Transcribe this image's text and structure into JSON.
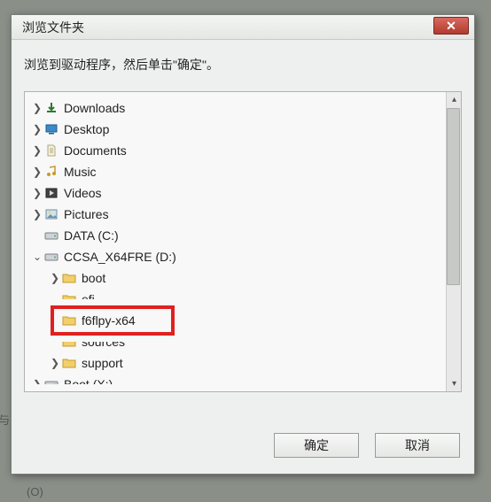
{
  "dialog": {
    "title": "浏览文件夹",
    "close_symbol": "✕",
    "instruction": "浏览到驱动程序，然后单击\"确定\"。"
  },
  "tree": [
    {
      "indent": 1,
      "twisty": ">",
      "icon": "downloads",
      "label": "Downloads",
      "highlighted": false
    },
    {
      "indent": 1,
      "twisty": ">",
      "icon": "desktop",
      "label": "Desktop",
      "highlighted": false
    },
    {
      "indent": 1,
      "twisty": ">",
      "icon": "documents",
      "label": "Documents",
      "highlighted": false
    },
    {
      "indent": 1,
      "twisty": ">",
      "icon": "music",
      "label": "Music",
      "highlighted": false
    },
    {
      "indent": 1,
      "twisty": ">",
      "icon": "videos",
      "label": "Videos",
      "highlighted": false
    },
    {
      "indent": 1,
      "twisty": ">",
      "icon": "pictures",
      "label": "Pictures",
      "highlighted": false
    },
    {
      "indent": 1,
      "twisty": "",
      "icon": "drive",
      "label": "DATA (C:)",
      "highlighted": false
    },
    {
      "indent": 1,
      "twisty": "v",
      "icon": "drive",
      "label": "CCSA_X64FRE (D:)",
      "highlighted": false
    },
    {
      "indent": 2,
      "twisty": ">",
      "icon": "folder",
      "label": "boot",
      "highlighted": false
    },
    {
      "indent": 2,
      "twisty": "",
      "icon": "folder",
      "label": "efi",
      "highlighted": false,
      "cut": "bottom"
    },
    {
      "indent": 2,
      "twisty": "",
      "icon": "folder",
      "label": "f6flpy-x64",
      "highlighted": true
    },
    {
      "indent": 2,
      "twisty": "",
      "icon": "folder",
      "label": "sources",
      "highlighted": false,
      "cut": "top"
    },
    {
      "indent": 2,
      "twisty": ">",
      "icon": "folder",
      "label": "support",
      "highlighted": false
    },
    {
      "indent": 1,
      "twisty": ">",
      "icon": "drive",
      "label": "Boot (X:)",
      "highlighted": false,
      "cut": "bottom"
    }
  ],
  "buttons": {
    "ok": "确定",
    "cancel": "取消"
  },
  "side_text": "与",
  "bottom_text": "(O)"
}
